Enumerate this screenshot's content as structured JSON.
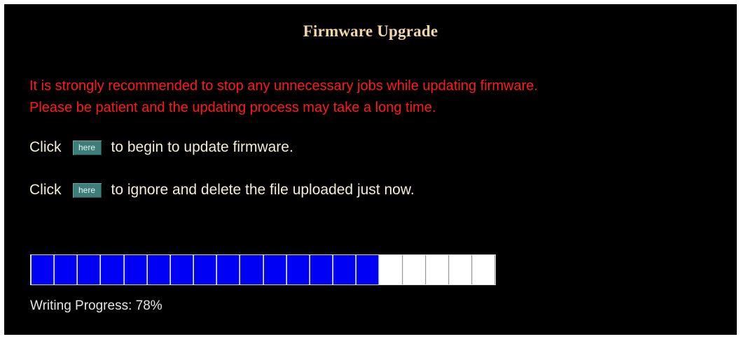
{
  "page": {
    "title": "Firmware Upgrade"
  },
  "warnings": {
    "line1": "It is strongly recommended to stop any unnecessary jobs while updating firmware.",
    "line2": "Please be patient and the updating process may take a long time."
  },
  "actions": {
    "update": {
      "prefix": "Click",
      "button_label": "here",
      "suffix": "to begin to update firmware."
    },
    "ignore": {
      "prefix": "Click",
      "button_label": "here",
      "suffix": "to ignore and delete the file uploaded just now."
    }
  },
  "progress": {
    "percent": 78,
    "segments_filled": 15,
    "segments_total": 20,
    "label": "Writing Progress: 78%",
    "fill_color": "#0000f4",
    "empty_color": "#ffffff"
  },
  "colors": {
    "background": "#000000",
    "title": "#f2d5a8",
    "warning": "#ff1a1a",
    "text": "#f3ecd6",
    "button": "#3d7e7a"
  }
}
